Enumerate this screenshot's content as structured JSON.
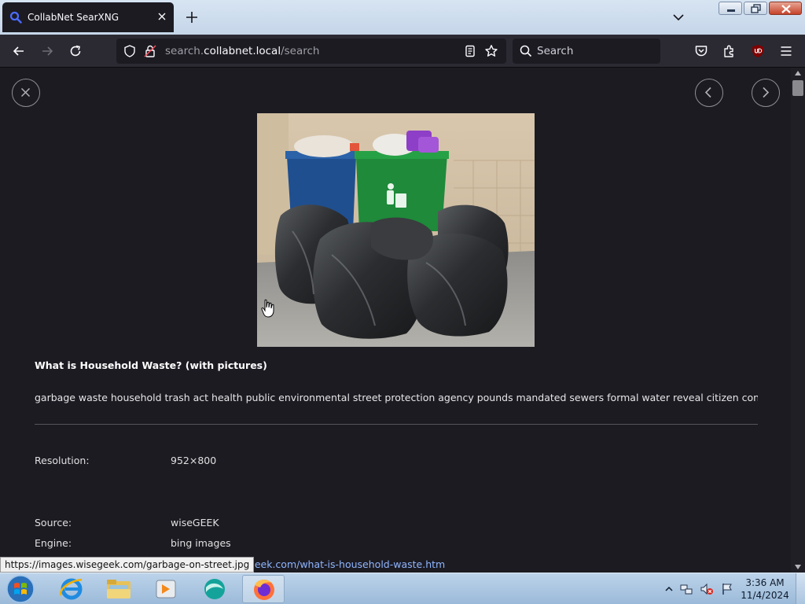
{
  "browser": {
    "tab_title": "CollabNet SearXNG",
    "url_prefix": "search.",
    "url_host": "collabnet.local",
    "url_path": "/search",
    "search_placeholder": "Search"
  },
  "content": {
    "result_title": "What is Household Waste? (with pictures)",
    "result_description": "garbage waste household trash act health public environmental street protection agency pounds mandated sewers formal water reveal citizen conducted prod...",
    "details": {
      "resolution_label": "Resolution:",
      "resolution_value": "952×800",
      "source_label": "Source:",
      "source_value": "wiseGEEK",
      "engine_label": "Engine:",
      "engine_value": "bing images",
      "page_link": "wisegeek.com/what-is-household-waste.htm"
    },
    "status_url": "https://images.wisegeek.com/garbage-on-street.jpg"
  },
  "taskbar": {
    "time": "3:36 AM",
    "date": "11/4/2024"
  }
}
